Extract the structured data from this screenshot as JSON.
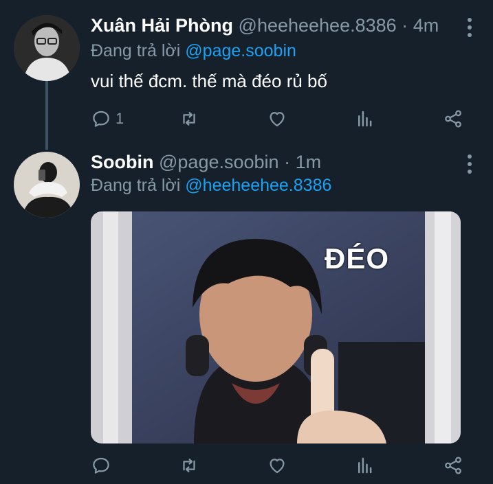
{
  "tweets": [
    {
      "name": "Xuân Hải Phòng",
      "handle": "@heeheehee.8386",
      "time": "4m",
      "replying_prefix": "Đang trả lời",
      "replying_to": "@page.soobin",
      "text": "vui thế đcm. thế mà đéo rủ bố",
      "reply_count": "1",
      "avatar_icon": "user-avatar"
    },
    {
      "name": "Soobin",
      "handle": "@page.soobin",
      "time": "1m",
      "replying_prefix": "Đang trả lời",
      "replying_to": "@heeheehee.8386",
      "media_caption": "ĐÉO",
      "avatar_icon": "user-avatar"
    }
  ],
  "separator": "·",
  "colors": {
    "background": "#15202b",
    "muted": "#8899a6",
    "accent": "#1da1f2",
    "thread_line": "#3d5466"
  },
  "icons": [
    "reply-icon",
    "retweet-icon",
    "like-icon",
    "analytics-icon",
    "share-icon",
    "more-icon"
  ]
}
